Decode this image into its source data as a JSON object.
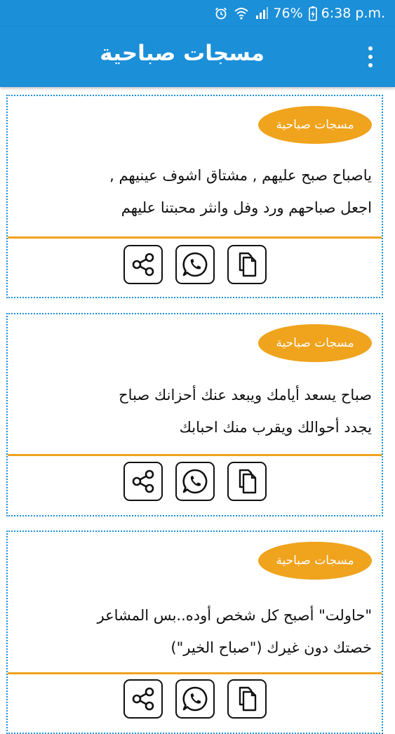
{
  "status": {
    "battery": "76%",
    "time": "6:38 p.m.",
    "icons": [
      "alarm-icon",
      "wifi-icon",
      "signal-icon",
      "battery-charging-icon"
    ]
  },
  "appbar": {
    "title": "مسجات صباحية",
    "menu_icon": "more-vertical-icon"
  },
  "cards": [
    {
      "badge": "مسجات صباحية",
      "line1": "ياصباح صبح عليهم , مشتاق اشوف عينيهم ,",
      "line2": "اجعل صباحهم ورد وفل وانثر محبتنا عليهم"
    },
    {
      "badge": "مسجات صباحية",
      "line1": "صباح يسعد أيامك ويبعد عنك أحزانك صباح",
      "line2": "يجدد أحوالك ويقرب منك احبابك"
    },
    {
      "badge": "مسجات صباحية",
      "line1": "\"حاولت\" أصبح كل شخص أوده..بس المشاعر",
      "line2": "خصتك دون غيرك (\"صباح الخير\")"
    }
  ],
  "actions": [
    "share-icon",
    "whatsapp-icon",
    "copy-icon"
  ],
  "colors": {
    "primary": "#1b8fd8",
    "accent": "#f0a31c"
  }
}
